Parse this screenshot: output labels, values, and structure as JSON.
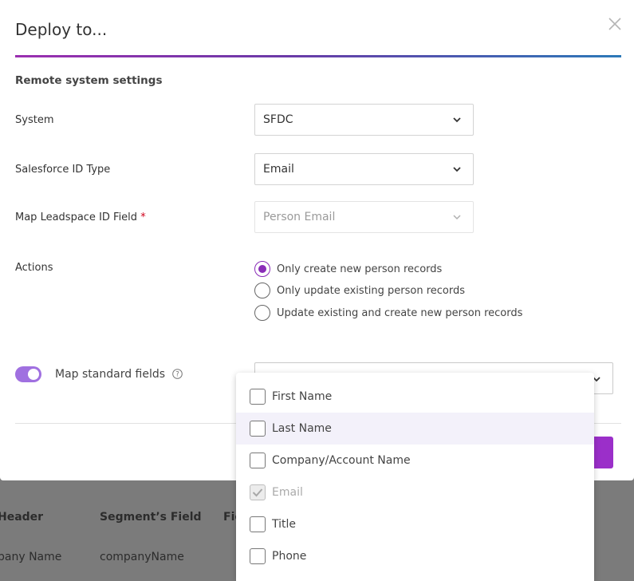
{
  "modal": {
    "title": "Deploy to...",
    "section_title": "Remote system settings",
    "fields": {
      "system": {
        "label": "System",
        "value": "SFDC"
      },
      "salesforce_id_type": {
        "label": "Salesforce ID Type",
        "value": "Email"
      },
      "map_leadspace_id": {
        "label": "Map Leadspace ID Field",
        "required_mark": "*",
        "value": "Person Email"
      }
    },
    "actions": {
      "label": "Actions",
      "options": [
        {
          "label": "Only create new person records",
          "checked": true
        },
        {
          "label": "Only update existing person records",
          "checked": false
        },
        {
          "label": "Update existing and create new person records",
          "checked": false
        }
      ]
    },
    "map_standard_fields": {
      "label": "Map standard fields",
      "enabled": true
    }
  },
  "dropdown": {
    "options": [
      {
        "label": "First Name",
        "checked": false,
        "disabled": false
      },
      {
        "label": "Last Name",
        "checked": false,
        "disabled": false
      },
      {
        "label": "Company/Account Name",
        "checked": false,
        "disabled": false
      },
      {
        "label": "Email",
        "checked": true,
        "disabled": true
      },
      {
        "label": "Title",
        "checked": false,
        "disabled": false
      },
      {
        "label": "Phone",
        "checked": false,
        "disabled": false
      }
    ]
  },
  "background_table": {
    "headers": [
      "Header",
      "Segment’s Field",
      "Fie"
    ],
    "row": [
      "pany Name",
      "companyName"
    ]
  },
  "colors": {
    "accent": "#9b2fc9",
    "toggle": "#a070e0",
    "required": "#d0021b",
    "hover_row": "#f3f1fa"
  }
}
